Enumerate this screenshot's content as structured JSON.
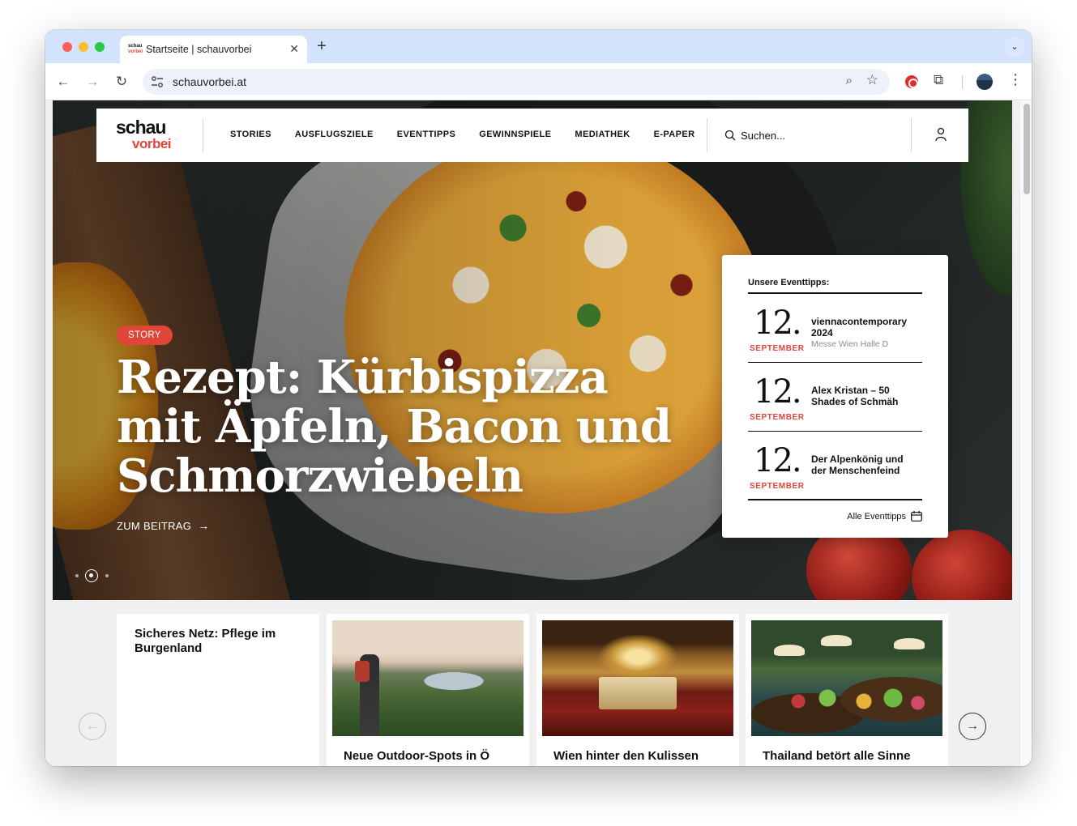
{
  "browser": {
    "tab_title": "Startseite | schauvorbei",
    "favicon_top": "schau",
    "favicon_bottom": "vorbei",
    "close_glyph": "✕",
    "newtab_glyph": "+",
    "tabsearch_glyph": "⌄",
    "url": "schauvorbei.at",
    "back_glyph": "←",
    "forward_glyph": "→",
    "reload_glyph": "↻",
    "zoom_glyph": "⌕",
    "star_glyph": "☆",
    "puzzle_glyph": "⧉",
    "menu_glyph": "⋮"
  },
  "site": {
    "logo_top": "schau",
    "logo_bottom": "vorbei",
    "accent_color": "#e0453a",
    "nav": [
      "STORIES",
      "AUSFLUGSZIELE",
      "EVENTTIPPS",
      "GEWINNSPIELE",
      "MEDIATHEK",
      "E-PAPER"
    ],
    "search_placeholder": "Suchen..."
  },
  "hero": {
    "badge": "STORY",
    "title": "Rezept: Kürbispizza mit Äpfeln, Bacon und Schmorzwiebeln",
    "link": "ZUM BEITRAG",
    "link_arrow": "→",
    "slides_total": 3,
    "active_slide": 2
  },
  "events": {
    "heading": "Unsere Eventtipps:",
    "items": [
      {
        "day": "12.",
        "month": "SEPTEMBER",
        "name": "viennacontemporary 2024",
        "venue": "Messe Wien Halle D"
      },
      {
        "day": "12.",
        "month": "SEPTEMBER",
        "name": "Alex Kristan – 50 Shades of Schmäh",
        "venue": ""
      },
      {
        "day": "12.",
        "month": "SEPTEMBER",
        "name": "Der Alpenkönig und der Menschenfeind",
        "venue": ""
      }
    ],
    "all_link": "Alle Eventtipps"
  },
  "cards": [
    {
      "title": "Sicheres Netz: Pflege im Burgenland"
    },
    {
      "title": "Neue Outdoor-Spots in Ö"
    },
    {
      "title": "Wien hinter den Kulissen"
    },
    {
      "title": "Thailand betört alle Sinne"
    }
  ],
  "carousel": {
    "prev_glyph": "←",
    "next_glyph": "→"
  }
}
